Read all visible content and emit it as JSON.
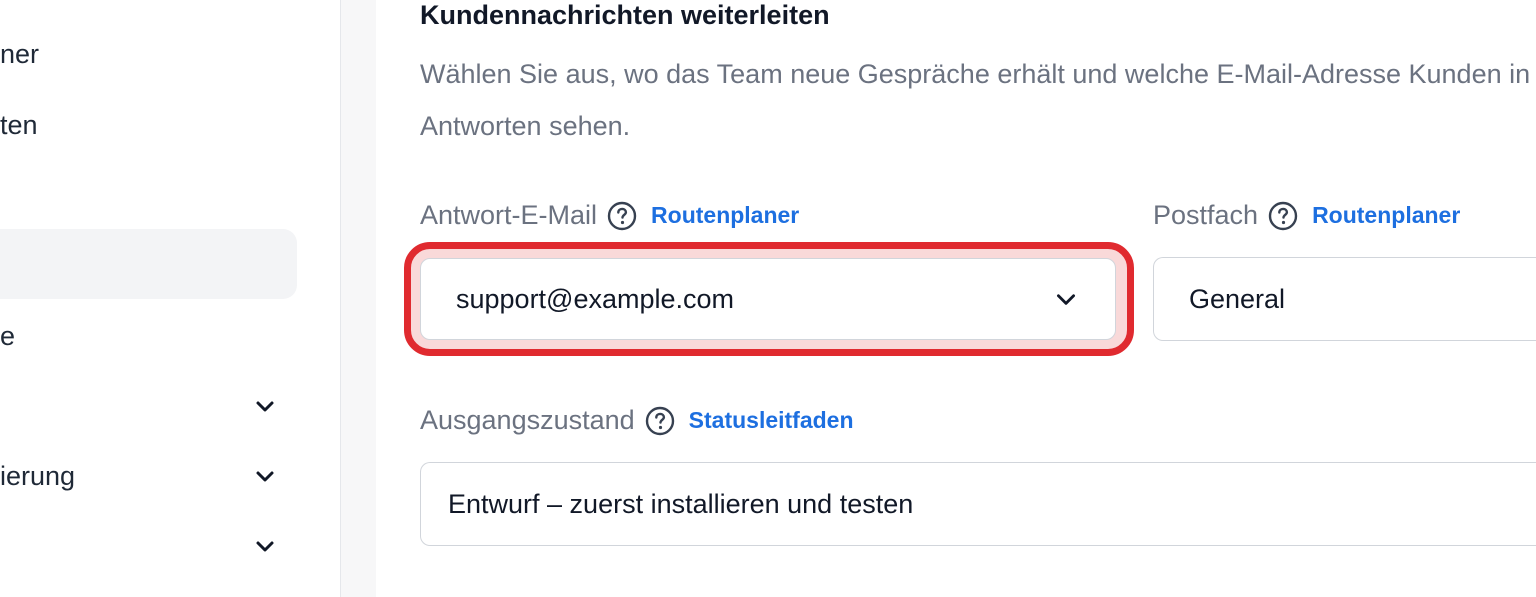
{
  "sidebar": {
    "items": [
      {
        "label": "ner",
        "has_chevron": false
      },
      {
        "label": "ten",
        "has_chevron": false
      },
      {
        "label": "",
        "has_chevron": false,
        "active": true
      },
      {
        "label": "e",
        "has_chevron": false
      },
      {
        "label": "",
        "has_chevron": true
      },
      {
        "label": "ierung",
        "has_chevron": true
      },
      {
        "label": "",
        "has_chevron": true
      }
    ]
  },
  "section": {
    "title": "Kundennachrichten weiterleiten",
    "description": "Wählen Sie aus, wo das Team neue Gespräche erhält und welche E-Mail-Adresse Kunden in Antworten sehen."
  },
  "fields": {
    "reply_email": {
      "label": "Antwort-E-Mail",
      "link": "Routenplaner",
      "value": "support@example.com"
    },
    "mailbox": {
      "label": "Postfach",
      "link": "Routenplaner",
      "value": "General"
    },
    "initial_state": {
      "label": "Ausgangszustand",
      "link": "Statusleitfaden",
      "value": "Entwurf – zuerst installieren und testen"
    }
  },
  "colors": {
    "link": "#1d6fe0",
    "highlight": "#e02a2f",
    "muted_text": "#6b7280"
  }
}
